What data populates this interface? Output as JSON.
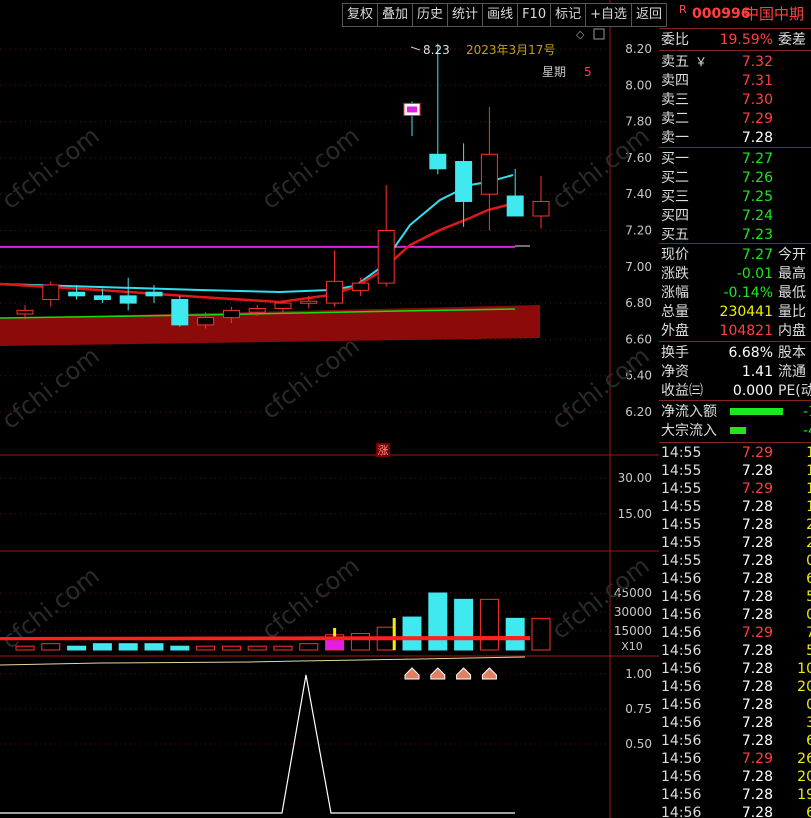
{
  "toolbar": [
    "复权",
    "叠加",
    "历史",
    "统计",
    "画线",
    "F10",
    "标记",
    "+自选",
    "返回"
  ],
  "header": {
    "badge": "R",
    "code": "000996",
    "name": "中国中期"
  },
  "quote": {
    "weibi": {
      "label": "委比",
      "value": "19.59%",
      "tail": "委差"
    },
    "asks": [
      {
        "label": "卖五",
        "mark": "￥",
        "price": "7.32"
      },
      {
        "label": "卖四",
        "price": "7.31"
      },
      {
        "label": "卖三",
        "price": "7.30"
      },
      {
        "label": "卖二",
        "price": "7.29"
      },
      {
        "label": "卖一",
        "price": "7.28"
      }
    ],
    "bids": [
      {
        "label": "买一",
        "price": "7.27"
      },
      {
        "label": "买二",
        "price": "7.26"
      },
      {
        "label": "买三",
        "price": "7.25"
      },
      {
        "label": "买四",
        "price": "7.24"
      },
      {
        "label": "买五",
        "price": "7.23"
      }
    ],
    "stats": [
      {
        "label": "现价",
        "value": "7.27",
        "tail": "今开"
      },
      {
        "label": "涨跌",
        "value": "-0.01",
        "tail": "最高"
      },
      {
        "label": "涨幅",
        "value": "-0.14%",
        "tail": "最低"
      },
      {
        "label": "总量",
        "value": "230441",
        "tail": "量比"
      },
      {
        "label": "外盘",
        "value": "104821",
        "tail": "内盘"
      }
    ],
    "stats2": [
      {
        "label": "换手",
        "value": "6.68%",
        "tail": "股本"
      },
      {
        "label": "净资",
        "value": "1.41",
        "tail": "流通"
      },
      {
        "label": "收益㈢",
        "value": "0.000",
        "tail": "PE(动"
      }
    ],
    "flows": [
      {
        "label": "净流入额",
        "value": "-1"
      },
      {
        "label": "大宗流入",
        "value": "-4"
      }
    ]
  },
  "ticks": [
    [
      "14:55",
      "7.29",
      "1"
    ],
    [
      "14:55",
      "7.28",
      "1"
    ],
    [
      "14:55",
      "7.29",
      "1"
    ],
    [
      "14:55",
      "7.28",
      "1"
    ],
    [
      "14:55",
      "7.28",
      "2"
    ],
    [
      "14:55",
      "7.28",
      "2"
    ],
    [
      "14:55",
      "7.28",
      "0"
    ],
    [
      "14:56",
      "7.28",
      "6"
    ],
    [
      "14:56",
      "7.28",
      "5"
    ],
    [
      "14:56",
      "7.28",
      "0"
    ],
    [
      "14:56",
      "7.29",
      "7"
    ],
    [
      "14:56",
      "7.28",
      "5"
    ],
    [
      "14:56",
      "7.28",
      "10"
    ],
    [
      "14:56",
      "7.28",
      "20"
    ],
    [
      "14:56",
      "7.28",
      "0"
    ],
    [
      "14:56",
      "7.28",
      "3"
    ],
    [
      "14:56",
      "7.28",
      "6"
    ],
    [
      "14:56",
      "7.29",
      "26"
    ],
    [
      "14:56",
      "7.28",
      "20"
    ],
    [
      "14:56",
      "7.28",
      "19"
    ],
    [
      "14:56",
      "7.28",
      "6"
    ]
  ],
  "overlay": {
    "date": "2023年3月17号",
    "weekday_label": "星期",
    "weekday": "5",
    "high_label": "8.23",
    "up_marker": "涨",
    "x10": "X10"
  },
  "watermark": "cfchi.com",
  "chart_data": {
    "type": "candlestick",
    "price_ticks": [
      "8.20",
      "8.00",
      "7.80",
      "7.60",
      "7.40",
      "7.20",
      "7.00",
      "6.80",
      "6.60",
      "6.40",
      "6.20"
    ],
    "indicator_ticks": [
      "30.00",
      "15.00"
    ],
    "volume_ticks": [
      "45000",
      "30000",
      "15000"
    ],
    "osc_ticks": [
      "1.00",
      "0.75",
      "0.50"
    ],
    "candles": [
      {
        "o": 6.74,
        "h": 6.79,
        "l": 6.71,
        "c": 6.76
      },
      {
        "o": 6.82,
        "h": 6.92,
        "l": 6.78,
        "c": 6.9
      },
      {
        "o": 6.86,
        "h": 6.9,
        "l": 6.82,
        "c": 6.84
      },
      {
        "o": 6.84,
        "h": 6.88,
        "l": 6.8,
        "c": 6.82
      },
      {
        "o": 6.84,
        "h": 6.94,
        "l": 6.76,
        "c": 6.8
      },
      {
        "o": 6.86,
        "h": 6.9,
        "l": 6.8,
        "c": 6.84
      },
      {
        "o": 6.82,
        "h": 6.84,
        "l": 6.67,
        "c": 6.68
      },
      {
        "o": 6.68,
        "h": 6.75,
        "l": 6.66,
        "c": 6.72
      },
      {
        "o": 6.72,
        "h": 6.78,
        "l": 6.69,
        "c": 6.76
      },
      {
        "o": 6.75,
        "h": 6.79,
        "l": 6.73,
        "c": 6.77
      },
      {
        "o": 6.77,
        "h": 6.81,
        "l": 6.74,
        "c": 6.8
      },
      {
        "o": 6.8,
        "h": 6.84,
        "l": 6.77,
        "c": 6.81
      },
      {
        "o": 6.8,
        "h": 7.09,
        "l": 6.78,
        "c": 6.92
      },
      {
        "o": 6.87,
        "h": 6.94,
        "l": 6.84,
        "c": 6.91
      },
      {
        "o": 6.91,
        "h": 7.45,
        "l": 6.89,
        "c": 7.2
      },
      {
        "o": 7.9,
        "h": 7.91,
        "l": 7.72,
        "c": 7.84
      },
      {
        "o": 7.62,
        "h": 8.23,
        "l": 7.51,
        "c": 7.54
      },
      {
        "o": 7.58,
        "h": 7.68,
        "l": 7.22,
        "c": 7.36
      },
      {
        "o": 7.4,
        "h": 7.88,
        "l": 7.2,
        "c": 7.62
      },
      {
        "o": 7.39,
        "h": 7.54,
        "l": 7.28,
        "c": 7.28
      },
      {
        "o": 7.28,
        "h": 7.5,
        "l": 7.21,
        "c": 7.36
      }
    ],
    "volume": [
      3000,
      5000,
      3000,
      5000,
      5000,
      5000,
      3000,
      3000,
      3000,
      3000,
      3000,
      5000,
      12000,
      13000,
      18000,
      26000,
      45000,
      40000,
      40000,
      25000,
      25000
    ],
    "hline_price": 7.11,
    "osc_peak": 1.0
  }
}
